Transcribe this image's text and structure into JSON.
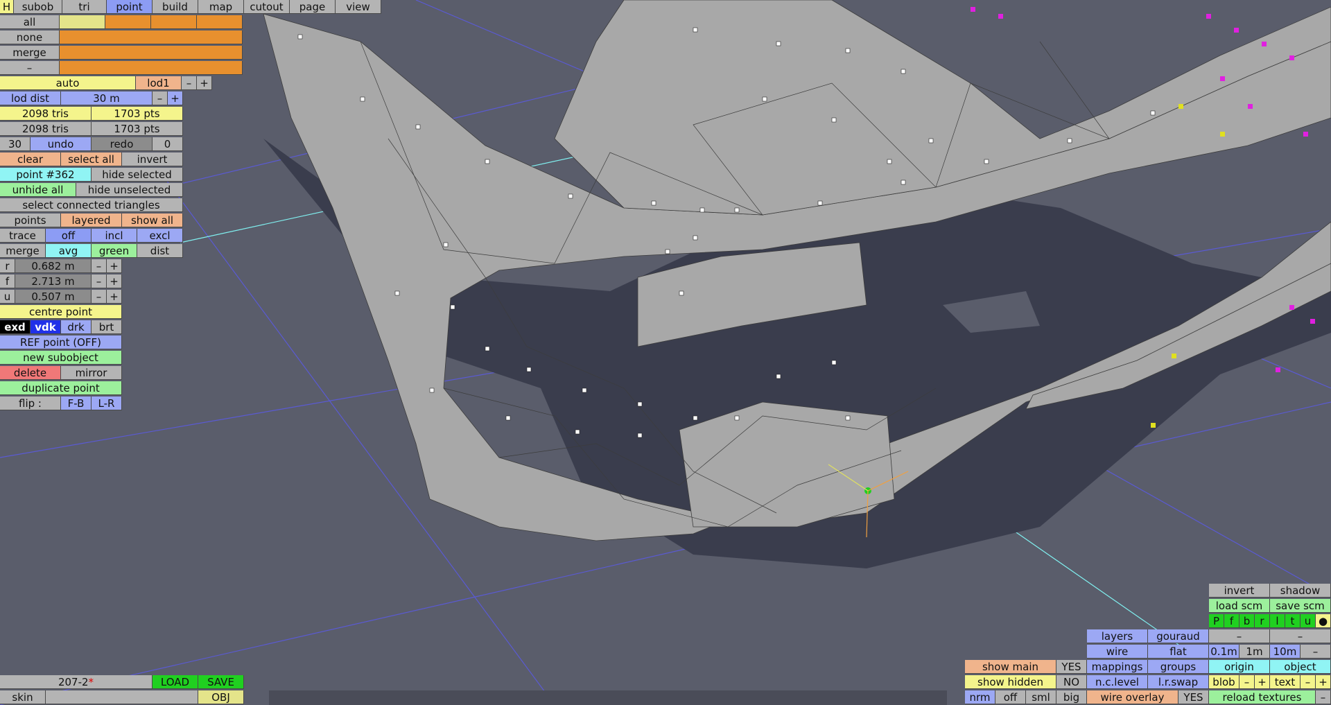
{
  "menu": {
    "tabs": [
      "H",
      "subob",
      "tri",
      "point",
      "build",
      "map",
      "cutout",
      "page",
      "view"
    ],
    "selected": "point"
  },
  "select_rows": [
    "all",
    "none",
    "merge",
    "–"
  ],
  "lod": {
    "auto": "auto",
    "lod1": "lod1",
    "minus": "–",
    "plus": "+",
    "dist_label": "lod dist",
    "dist_value": "30 m"
  },
  "stats": {
    "tris1": "2098 tris",
    "pts1": "1703 pts",
    "tris2": "2098 tris",
    "pts2": "1703 pts"
  },
  "undo": {
    "count": "30",
    "undo": "undo",
    "redo": "redo",
    "redo_count": "0"
  },
  "selection": {
    "clear": "clear",
    "select_all": "select all",
    "invert": "invert"
  },
  "point": {
    "label": "point #362",
    "hide_selected": "hide selected",
    "unhide_all": "unhide all",
    "hide_unselected": "hide unselected",
    "select_connected": "select connected triangles"
  },
  "view_opts": {
    "points": "points",
    "layered": "layered",
    "show_all": "show all"
  },
  "trace": {
    "label": "trace",
    "off": "off",
    "incl": "incl",
    "excl": "excl"
  },
  "merge_row": {
    "merge": "merge",
    "avg": "avg",
    "green": "green",
    "dist": "dist"
  },
  "coords": [
    {
      "axis": "r",
      "value": "0.682 m"
    },
    {
      "axis": "f",
      "value": "2.713 m"
    },
    {
      "axis": "u",
      "value": "0.507 m"
    }
  ],
  "centre_point": "centre point",
  "render_modes": [
    "exd",
    "vdk",
    "drk",
    "brt"
  ],
  "ref_point": "REF point (OFF)",
  "new_subobject": "new subobject",
  "delete": "delete",
  "mirror": "mirror",
  "duplicate_point": "duplicate point",
  "flip": {
    "label": "flip :",
    "fb": "F-B",
    "lr": "L-R"
  },
  "file": {
    "name": "207-2",
    "modified": "*",
    "load": "LOAD",
    "save": "SAVE",
    "skin": "skin",
    "obj": "OBJ"
  },
  "right_panel": {
    "invert": "invert",
    "shadow": "shadow",
    "load_scm": "load scm",
    "save_scm": "save scm",
    "toggles": [
      "P",
      "f",
      "b",
      "r",
      "l",
      "t",
      "u",
      "●"
    ],
    "dash1": "–",
    "dash2": "–",
    "layers": "layers",
    "gouraud": "gouraud",
    "wire": "wire",
    "flat": "flat",
    "steps": [
      "0.1m",
      "1m",
      "10m",
      "–"
    ],
    "show_main": "show main",
    "show_main_val": "YES",
    "mappings": "mappings",
    "groups": "groups",
    "origin": "origin",
    "object": "object",
    "show_hidden": "show hidden",
    "show_hidden_val": "NO",
    "nc_level": "n.c.level",
    "lr_swap": "l.r.swap",
    "blob": "blob",
    "text": "text",
    "nrm": "nrm",
    "off": "off",
    "sml": "sml",
    "big": "big",
    "wire_overlay": "wire overlay",
    "wire_overlay_val": "YES",
    "reload_textures": "reload textures"
  },
  "colors": {
    "background": "#5a5d6b",
    "mesh": "#a8a8a8",
    "shadow": "#3a3d4d",
    "grid": "#5a5aee",
    "vertex": "#ffffff",
    "selected_vertex": "#e020e0"
  }
}
